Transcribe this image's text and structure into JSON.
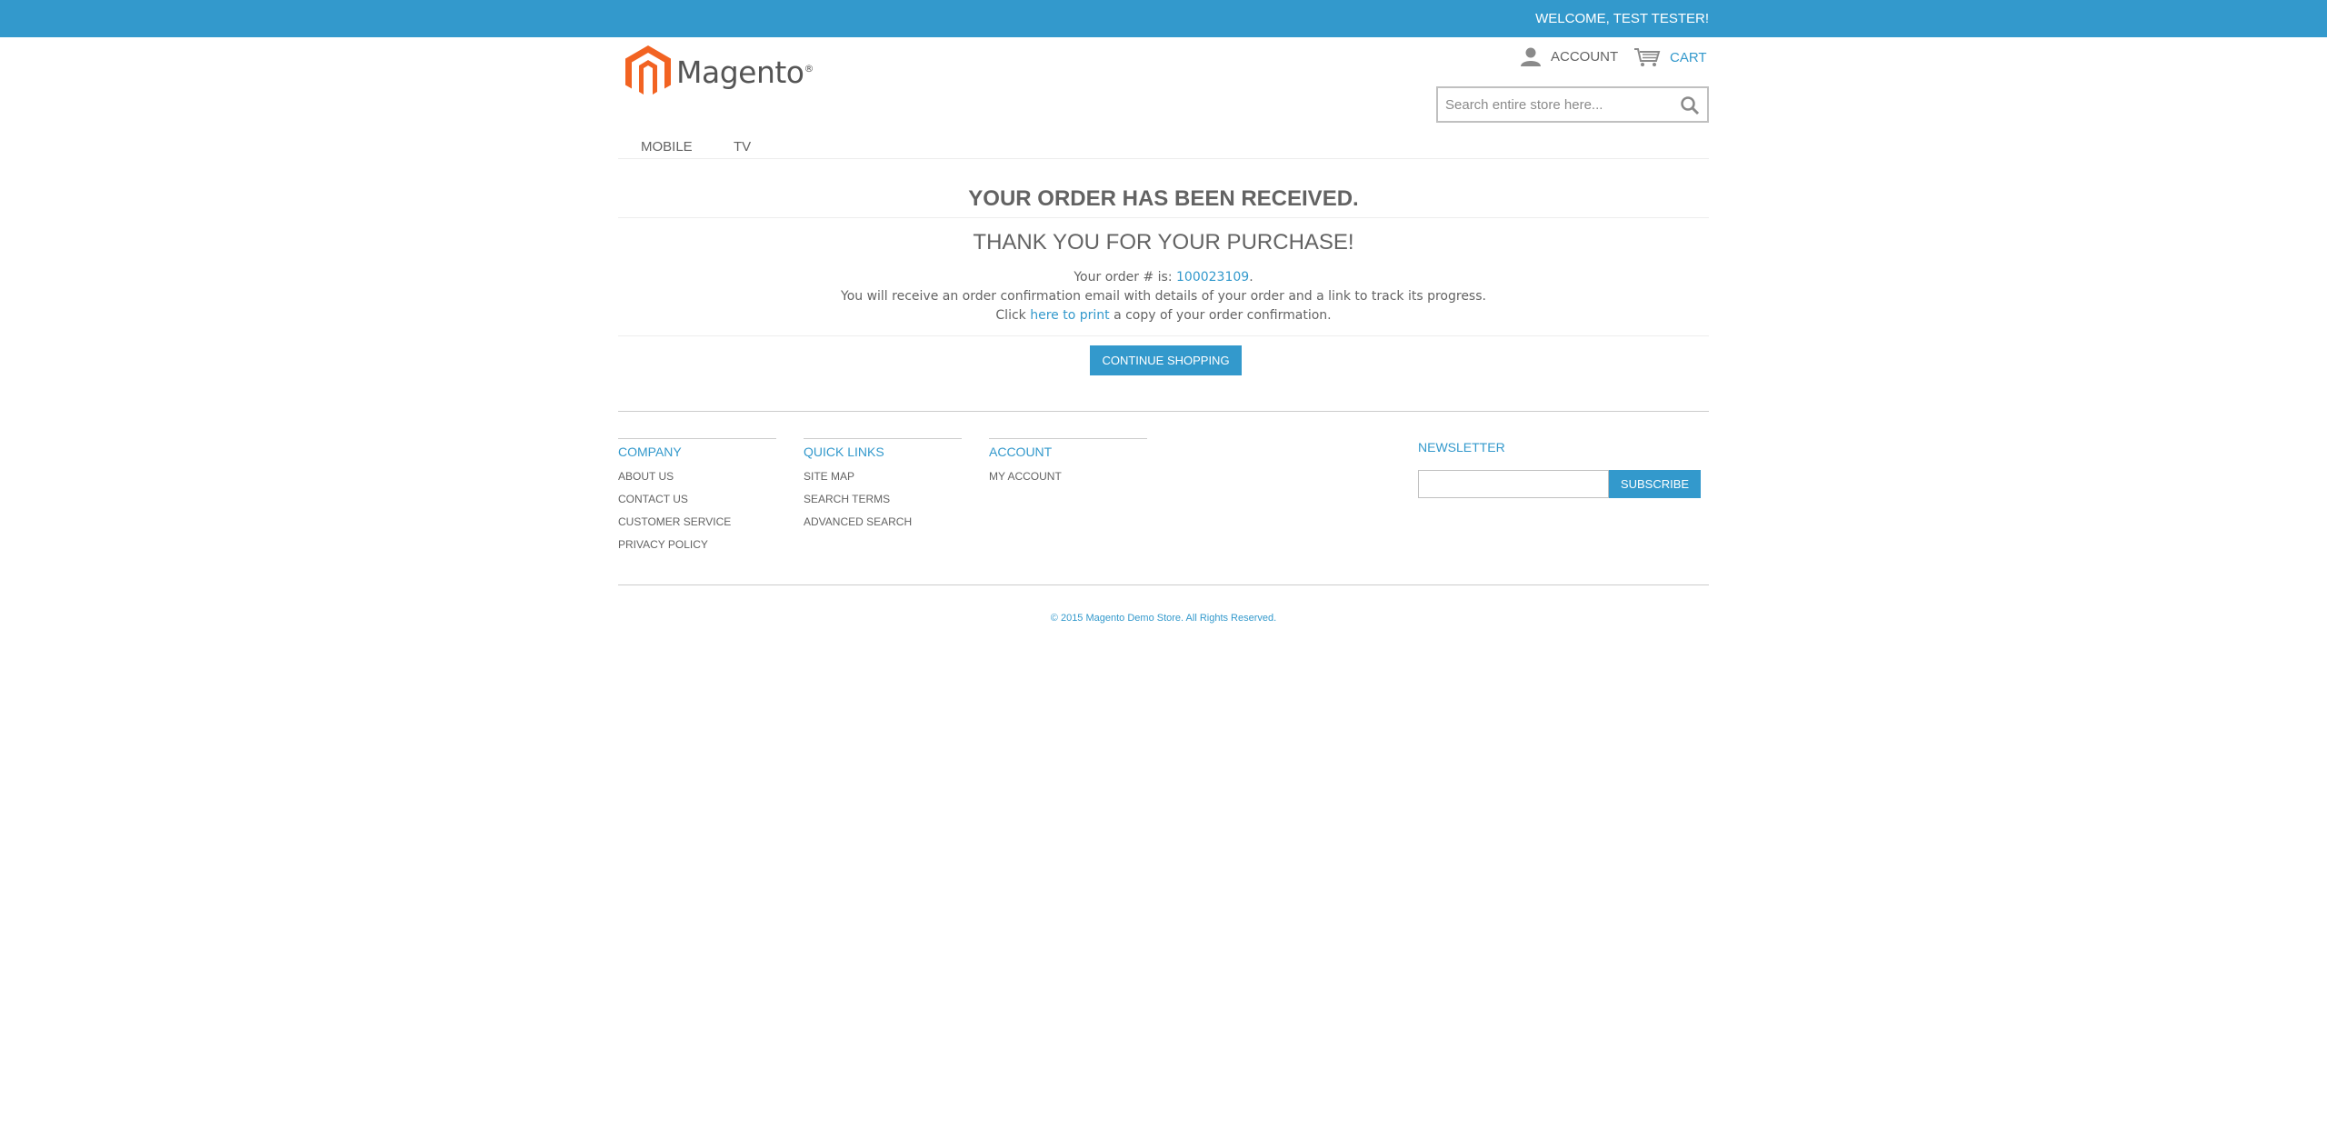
{
  "header": {
    "welcome": "WELCOME, TEST TESTER!",
    "logo_text": "Magento",
    "logo_mark": "®",
    "account_label": "ACCOUNT",
    "cart_label": "CART",
    "search_placeholder": "Search entire store here..."
  },
  "nav": {
    "items": [
      {
        "label": "MOBILE"
      },
      {
        "label": "TV"
      }
    ]
  },
  "main": {
    "title": "YOUR ORDER HAS BEEN RECEIVED.",
    "subtitle": "THANK YOU FOR YOUR PURCHASE!",
    "order_prefix": "Your order # is: ",
    "order_number": "100023109",
    "order_suffix": ".",
    "email_text": "You will receive an order confirmation email with details of your order and a link to track its progress.",
    "print_prefix": "Click ",
    "print_link": "here to print",
    "print_suffix": " a copy of your order confirmation.",
    "continue_button": "CONTINUE SHOPPING"
  },
  "footer": {
    "columns": [
      {
        "title": "COMPANY",
        "items": [
          "ABOUT US",
          "CONTACT US",
          "CUSTOMER SERVICE",
          "PRIVACY POLICY"
        ]
      },
      {
        "title": "QUICK LINKS",
        "items": [
          "SITE MAP",
          "SEARCH TERMS",
          "ADVANCED SEARCH"
        ]
      },
      {
        "title": "ACCOUNT",
        "items": [
          "MY ACCOUNT"
        ]
      }
    ],
    "newsletter_title": "NEWSLETTER",
    "subscribe_button": "SUBSCRIBE",
    "copyright": "© 2015 Magento Demo Store. All Rights Reserved."
  },
  "colors": {
    "accent": "#3399cc",
    "logo_orange": "#f26322",
    "text": "#636363"
  },
  "icons": [
    "magento-logo-icon",
    "account-icon",
    "cart-icon",
    "search-icon"
  ]
}
